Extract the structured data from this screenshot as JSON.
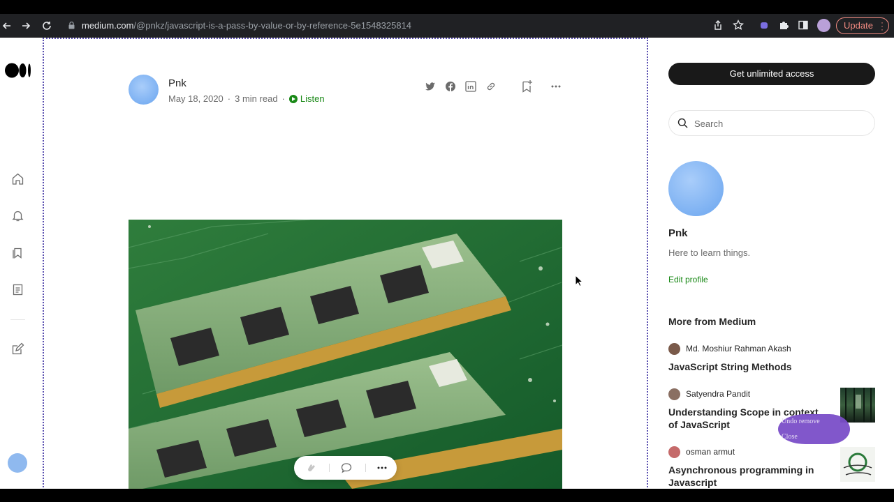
{
  "browser": {
    "url_host": "medium.com",
    "url_path": "/@pnkz/javascript-is-a-pass-by-value-or-by-reference-5e1548325814",
    "update_label": "Update"
  },
  "article": {
    "author": "Pnk",
    "date": "May 18, 2020",
    "read_time": "3 min read",
    "listen_label": "Listen"
  },
  "sidebar": {
    "cta_label": "Get unlimited access",
    "search_placeholder": "Search",
    "profile_name": "Pnk",
    "profile_bio": "Here to learn things.",
    "edit_profile_label": "Edit profile",
    "more_title": "More from Medium",
    "recommendations": [
      {
        "author": "Md. Moshiur Rahman Akash",
        "title": "JavaScript String Methods"
      },
      {
        "author": "Satyendra Pandit",
        "title": "Understanding Scope in context of JavaScript"
      },
      {
        "author": "osman armut",
        "title": "Asynchronous programming in Javascript"
      }
    ]
  },
  "undo_popup": {
    "undo_label": "Undo remove",
    "close_label": "Close"
  }
}
